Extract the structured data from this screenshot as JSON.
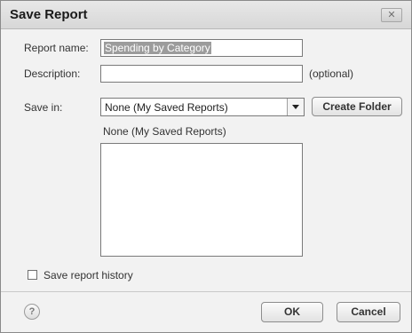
{
  "dialog": {
    "title": "Save Report",
    "close_label": "✕"
  },
  "form": {
    "report_name_label": "Report name:",
    "report_name_value": "Spending by Category",
    "description_label": "Description:",
    "description_value": "",
    "optional_note": "(optional)",
    "save_in_label": "Save in:",
    "save_in_selected": "None (My Saved Reports)",
    "create_folder_label": "Create Folder",
    "folder_path_label": "None (My Saved Reports)",
    "folder_items": [],
    "save_history_label": "Save report history",
    "save_history_checked": false
  },
  "footer": {
    "help_label": "?",
    "ok_label": "OK",
    "cancel_label": "Cancel"
  },
  "icons": {
    "close": "close-icon",
    "dropdown": "chevron-down-icon",
    "help": "help-icon"
  }
}
